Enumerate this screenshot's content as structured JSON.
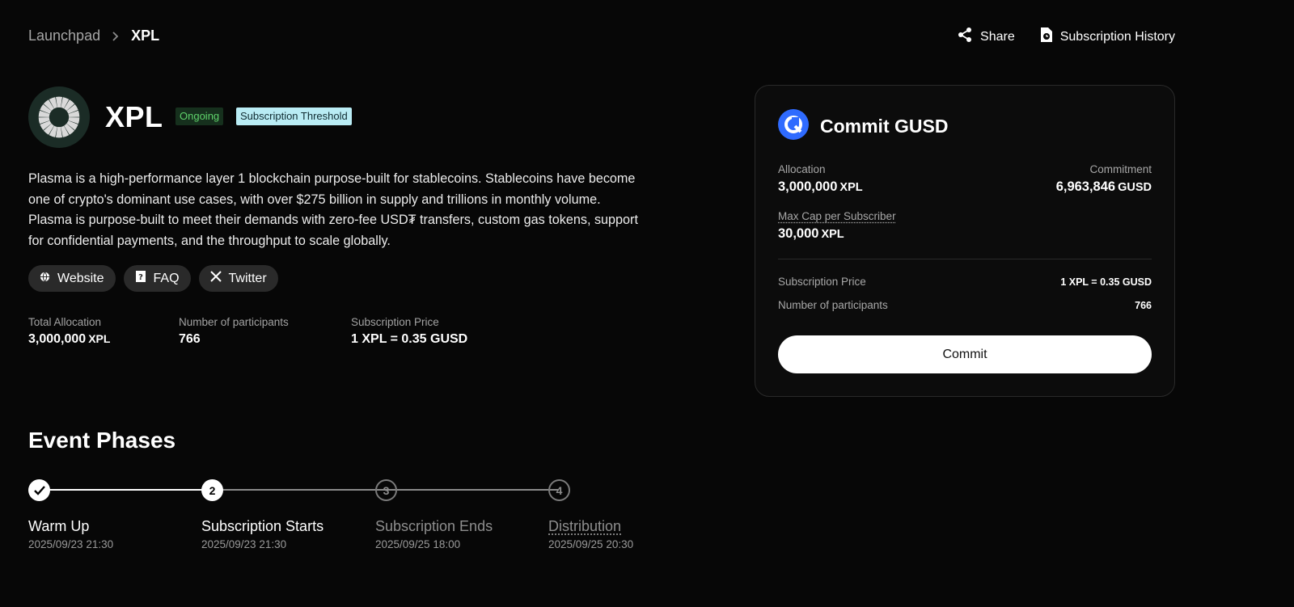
{
  "breadcrumb": {
    "root": "Launchpad",
    "current": "XPL"
  },
  "top_actions": {
    "share": "Share",
    "history": "Subscription History"
  },
  "project": {
    "name": "XPL",
    "status": "Ongoing",
    "tag": "Subscription Threshold",
    "description": "Plasma is a high-performance layer 1 blockchain purpose-built for stablecoins. Stablecoins have become one of crypto's dominant use cases, with over $275 billion in supply and trillions in monthly volume. Plasma is purpose-built to meet their demands with zero-fee USD₮ transfers, custom gas tokens, support for confidential payments, and the throughput to scale globally."
  },
  "links": {
    "website": "Website",
    "faq": "FAQ",
    "twitter": "Twitter"
  },
  "stats": {
    "total_allocation_label": "Total Allocation",
    "total_allocation_value": "3,000,000",
    "total_allocation_unit": "XPL",
    "participants_label": "Number of participants",
    "participants_value": "766",
    "price_label": "Subscription Price",
    "price_value": "1 XPL = 0.35 GUSD"
  },
  "phases": {
    "title": "Event Phases",
    "items": [
      {
        "step": "",
        "name": "Warm Up",
        "date": "2025/09/23 21:30",
        "state": "done"
      },
      {
        "step": "2",
        "name": "Subscription Starts",
        "date": "2025/09/23 21:30",
        "state": "active"
      },
      {
        "step": "3",
        "name": "Subscription Ends",
        "date": "2025/09/25 18:00",
        "state": "future"
      },
      {
        "step": "4",
        "name": "Distribution",
        "date": "2025/09/25 20:30",
        "state": "future"
      }
    ]
  },
  "card": {
    "title": "Commit GUSD",
    "allocation_label": "Allocation",
    "allocation_value": "3,000,000",
    "allocation_unit": "XPL",
    "commitment_label": "Commitment",
    "commitment_value": "6,963,846",
    "commitment_unit": "GUSD",
    "max_cap_label": "Max Cap per Subscriber",
    "max_cap_value": "30,000",
    "max_cap_unit": "XPL",
    "price_label": "Subscription Price",
    "price_value": "1 XPL = 0.35 GUSD",
    "participants_label": "Number of participants",
    "participants_value": "766",
    "button": "Commit"
  },
  "colors": {
    "background": "#070707",
    "ongoing": "#5fd36b",
    "threshold_badge": "#b9ecf4",
    "gusd_icon": "#2f6bff"
  },
  "icons": {
    "share": "share-icon",
    "history": "history-icon",
    "website": "globe-icon",
    "faq": "faq-icon",
    "twitter": "x-icon",
    "gusd": "gusd-icon"
  }
}
